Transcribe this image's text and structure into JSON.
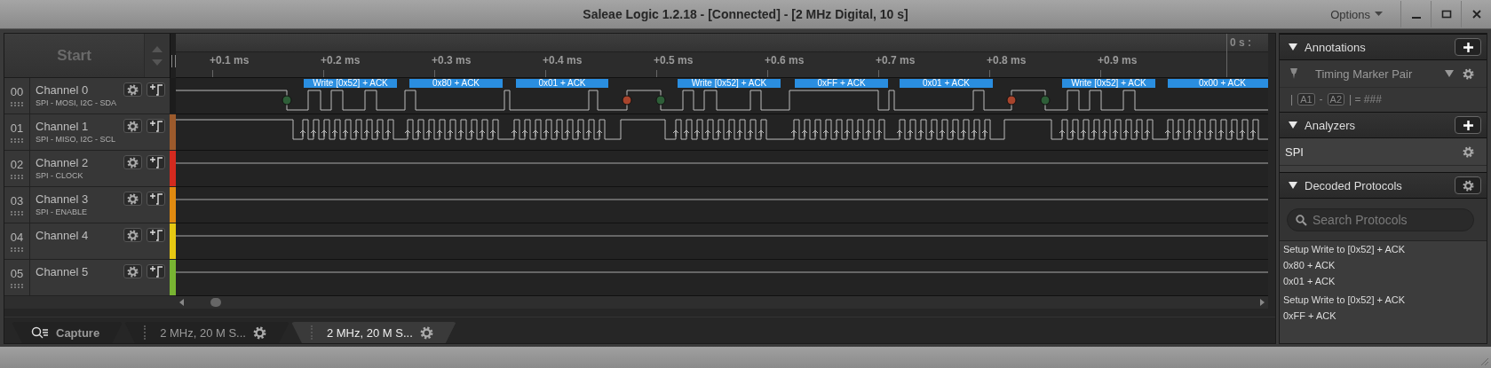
{
  "window": {
    "title": "Saleae Logic 1.2.18 - [Connected] - [2 MHz Digital, 10 s]",
    "options_label": "Options"
  },
  "start_button": {
    "label": "Start"
  },
  "ruler": {
    "ticks": [
      "+0.1 ms",
      "+0.2 ms",
      "+0.3 ms",
      "+0.4 ms",
      "+0.5 ms",
      "+0.6 ms",
      "+0.7 ms",
      "+0.8 ms",
      "+0.9 ms"
    ],
    "cursor_time": "0 s :"
  },
  "channels": [
    {
      "number": "00",
      "name": "Channel 0",
      "subtitle": "SPI - MOSI, I2C - SDA",
      "color": "#1c1c1c",
      "decoded": [
        "Write [0x52] + ACK",
        "0x80 + ACK",
        "0x01 + ACK",
        "Write [0x52] + ACK",
        "0xFF + ACK",
        "0x01 + ACK",
        "Write [0x52] + ACK",
        "0x00 + ACK"
      ]
    },
    {
      "number": "01",
      "name": "Channel 1",
      "subtitle": "SPI - MISO, I2C - SCL",
      "color": "#9c5a2c"
    },
    {
      "number": "02",
      "name": "Channel 2",
      "subtitle": "SPI - CLOCK",
      "color": "#d42a1f"
    },
    {
      "number": "03",
      "name": "Channel 3",
      "subtitle": "SPI - ENABLE",
      "color": "#e08a10"
    },
    {
      "number": "04",
      "name": "Channel 4",
      "color": "#e6c812"
    },
    {
      "number": "05",
      "name": "Channel 5",
      "color": "#78b432"
    }
  ],
  "tabs": [
    {
      "label": "Capture",
      "kind": "capture",
      "selected": false
    },
    {
      "label": "2 MHz, 20 M S...",
      "kind": "session",
      "selected": false
    },
    {
      "label": "2 MHz, 20 M S...",
      "kind": "session",
      "selected": true
    }
  ],
  "annotations": {
    "title": "Annotations",
    "marker": "Timing Marker Pair",
    "formula": [
      {
        "kind": "text",
        "text": "|"
      },
      {
        "kind": "marker",
        "text": "A1"
      },
      {
        "kind": "text",
        "text": "-"
      },
      {
        "kind": "marker",
        "text": "A2"
      },
      {
        "kind": "text",
        "text": "| = ###"
      }
    ]
  },
  "analyzers": {
    "title": "Analyzers",
    "items": [
      "SPI"
    ]
  },
  "decoded_protocols": {
    "title": "Decoded Protocols",
    "search": {
      "placeholder": "Search Protocols"
    },
    "items": [
      "Setup Write to [0x52] + ACK",
      "0x80 + ACK",
      "0x01 + ACK",
      "Setup Write to [0x52] + ACK",
      "0xFF + ACK"
    ]
  }
}
